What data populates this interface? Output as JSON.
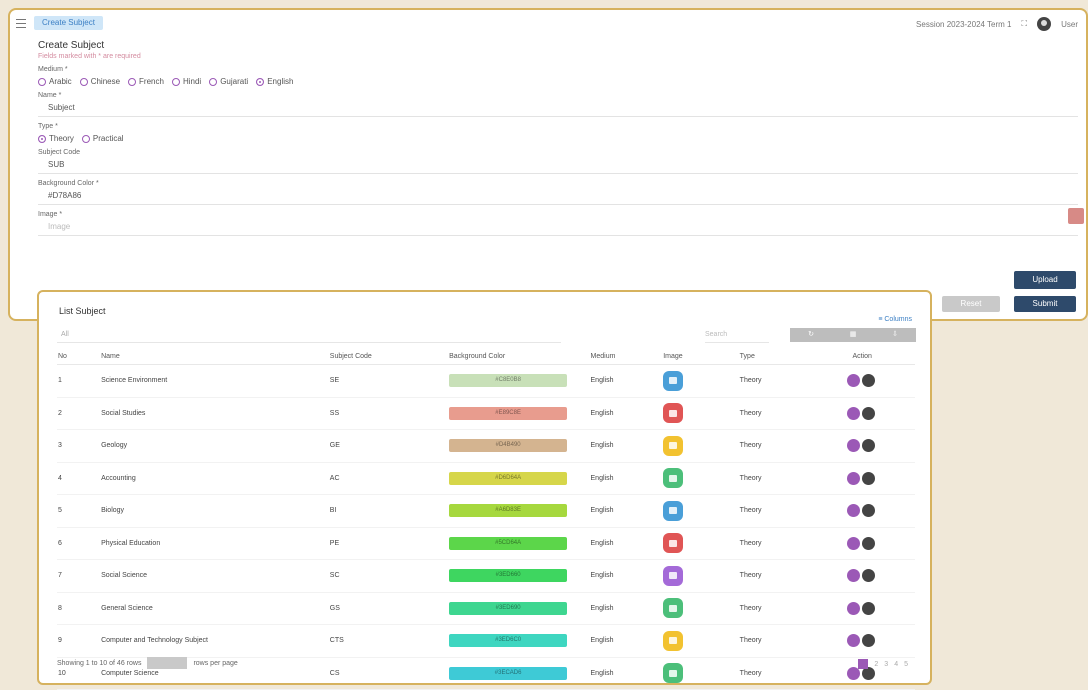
{
  "topbar": {
    "chip": "Create Subject",
    "right_text": "Session 2023-2024 Term 1",
    "user": "User"
  },
  "form": {
    "title": "Create Subject",
    "subtitle": "Fields marked with * are required",
    "label_medium": "Medium *",
    "mediums": [
      {
        "label": "Arabic",
        "checked": false
      },
      {
        "label": "Chinese",
        "checked": false
      },
      {
        "label": "French",
        "checked": false
      },
      {
        "label": "Hindi",
        "checked": false
      },
      {
        "label": "Gujarati",
        "checked": false
      },
      {
        "label": "English",
        "checked": true
      }
    ],
    "label_name": "Name *",
    "name_value": "Subject",
    "label_type": "Type *",
    "types": [
      {
        "label": "Theory",
        "checked": true
      },
      {
        "label": "Practical",
        "checked": false
      }
    ],
    "label_code": "Subject Code",
    "code_value": "SUB",
    "label_bg": "Background Color *",
    "bg_value": "#D78A86",
    "label_image": "Image *",
    "image_placeholder": "Image",
    "upload_label": "Upload",
    "reset_label": "Reset",
    "submit_label": "Submit"
  },
  "list": {
    "title": "List Subject",
    "tools": "≡ Columns",
    "filter_placeholder": "All",
    "search_placeholder": "Search",
    "segments": [
      "",
      "",
      ""
    ],
    "columns": [
      "No",
      "Name",
      "Subject Code",
      "Background Color",
      "Medium",
      "Image",
      "Type",
      "Action"
    ],
    "rows": [
      {
        "no": "1",
        "name": "Science Environment",
        "code": "SE",
        "bg": "#c8e0b8",
        "bg_label": "#C8E0B8",
        "medium": "English",
        "img": "#4a9fd8",
        "type": "Theory"
      },
      {
        "no": "2",
        "name": "Social Studies",
        "code": "SS",
        "bg": "#e89c8e",
        "bg_label": "#E89C8E",
        "medium": "English",
        "img": "#e05555",
        "type": "Theory"
      },
      {
        "no": "3",
        "name": "Geology",
        "code": "GE",
        "bg": "#d4b490",
        "bg_label": "#D4B490",
        "medium": "English",
        "img": "#f2c230",
        "type": "Theory"
      },
      {
        "no": "4",
        "name": "Accounting",
        "code": "AC",
        "bg": "#d6d64a",
        "bg_label": "#D6D64A",
        "medium": "English",
        "img": "#4cbf7a",
        "type": "Theory"
      },
      {
        "no": "5",
        "name": "Biology",
        "code": "BI",
        "bg": "#a6d83e",
        "bg_label": "#A6D83E",
        "medium": "English",
        "img": "#4a9fd8",
        "type": "Theory"
      },
      {
        "no": "6",
        "name": "Physical Education",
        "code": "PE",
        "bg": "#5cd64a",
        "bg_label": "#5CD64A",
        "medium": "English",
        "img": "#e05555",
        "type": "Theory"
      },
      {
        "no": "7",
        "name": "Social Science",
        "code": "SC",
        "bg": "#3ed660",
        "bg_label": "#3ED660",
        "medium": "English",
        "img": "#a46ad8",
        "type": "Theory"
      },
      {
        "no": "8",
        "name": "General Science",
        "code": "GS",
        "bg": "#3ed690",
        "bg_label": "#3ED690",
        "medium": "English",
        "img": "#4cbf7a",
        "type": "Theory"
      },
      {
        "no": "9",
        "name": "Computer and Technology Subject",
        "code": "CTS",
        "bg": "#3ed6c0",
        "bg_label": "#3ED6C0",
        "medium": "English",
        "img": "#f2c230",
        "type": "Theory"
      },
      {
        "no": "10",
        "name": "Computer Science",
        "code": "CS",
        "bg": "#3ecad6",
        "bg_label": "#3ECAD6",
        "medium": "English",
        "img": "#4cbf7a",
        "type": "Theory"
      }
    ],
    "footer_text": "Showing 1 to 10 of 46 rows",
    "footer_suffix": "rows per page",
    "pages": [
      "1",
      "2",
      "3",
      "4",
      "5"
    ]
  }
}
